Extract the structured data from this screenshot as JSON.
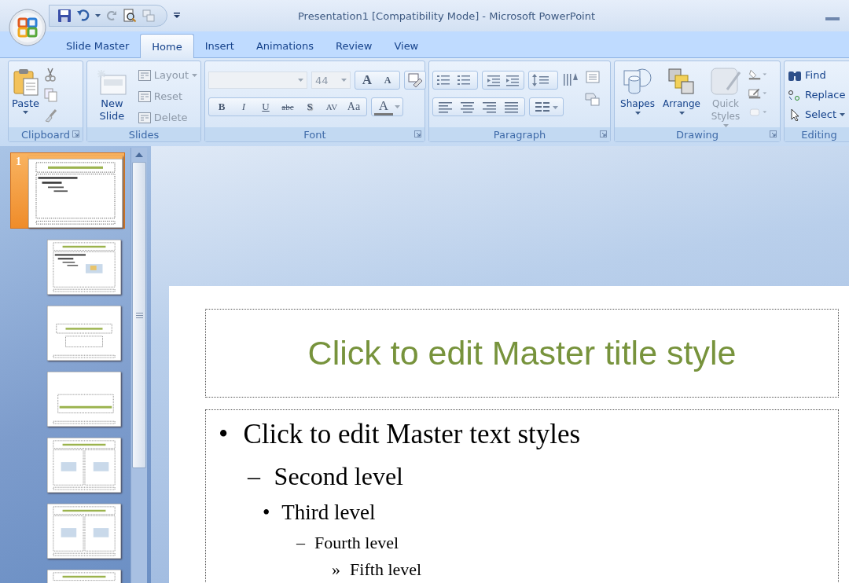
{
  "window": {
    "title": "Presentation1 [Compatibility Mode] - Microsoft PowerPoint"
  },
  "tabs": [
    {
      "label": "Slide Master",
      "selected": false
    },
    {
      "label": "Home",
      "selected": true
    },
    {
      "label": "Insert",
      "selected": false
    },
    {
      "label": "Animations",
      "selected": false
    },
    {
      "label": "Review",
      "selected": false
    },
    {
      "label": "View",
      "selected": false
    }
  ],
  "ribbon": {
    "groups": [
      {
        "kind": "clipboard",
        "label": "Clipboard",
        "launcher": true,
        "buttons": [
          {
            "label": "Paste",
            "disabled": false
          }
        ]
      },
      {
        "kind": "slides",
        "label": "Slides",
        "launcher": false,
        "buttons": [
          {
            "label": "New Slide",
            "disabled": false
          },
          {
            "label": "Layout",
            "disabled": true
          },
          {
            "label": "Reset",
            "disabled": true
          },
          {
            "label": "Delete",
            "disabled": true
          }
        ]
      },
      {
        "kind": "font",
        "label": "Font",
        "launcher": true,
        "font_size": "44",
        "grow": "A",
        "shrink": "A",
        "styles": [
          "B",
          "I",
          "U",
          "abc",
          "S",
          "AV",
          "Aa"
        ],
        "color_button": "A"
      },
      {
        "kind": "paragraph",
        "label": "Paragraph",
        "launcher": true
      },
      {
        "kind": "drawing",
        "label": "Drawing",
        "launcher": true,
        "buttons": [
          {
            "label": "Shapes",
            "disabled": false
          },
          {
            "label": "Arrange",
            "disabled": false
          },
          {
            "label": "Quick Styles",
            "disabled": true
          }
        ]
      },
      {
        "kind": "editing",
        "label": "Editing",
        "launcher": false,
        "buttons": [
          {
            "label": "Find"
          },
          {
            "label": "Replace"
          },
          {
            "label": "Select"
          }
        ]
      }
    ]
  },
  "slides": [
    {
      "number": "1",
      "kind": "master",
      "selected": true
    },
    {
      "kind": "title-content",
      "selected": false
    },
    {
      "kind": "title",
      "selected": false
    },
    {
      "kind": "section",
      "selected": false
    },
    {
      "kind": "two-content",
      "selected": false
    },
    {
      "kind": "comparison",
      "selected": false
    },
    {
      "kind": "title-only",
      "selected": false
    }
  ],
  "slide": {
    "title": "Click to edit Master title style",
    "body": [
      {
        "bullet": "•",
        "text": "Click to edit Master text styles",
        "children": [
          {
            "bullet": "–",
            "text": "Second level",
            "children": [
              {
                "bullet": "•",
                "text": "Third level",
                "children": [
                  {
                    "bullet": "–",
                    "text": "Fourth level",
                    "children": [
                      {
                        "bullet": "»",
                        "text": "Fifth level"
                      }
                    ]
                  }
                ]
              }
            ]
          }
        ]
      }
    ]
  }
}
